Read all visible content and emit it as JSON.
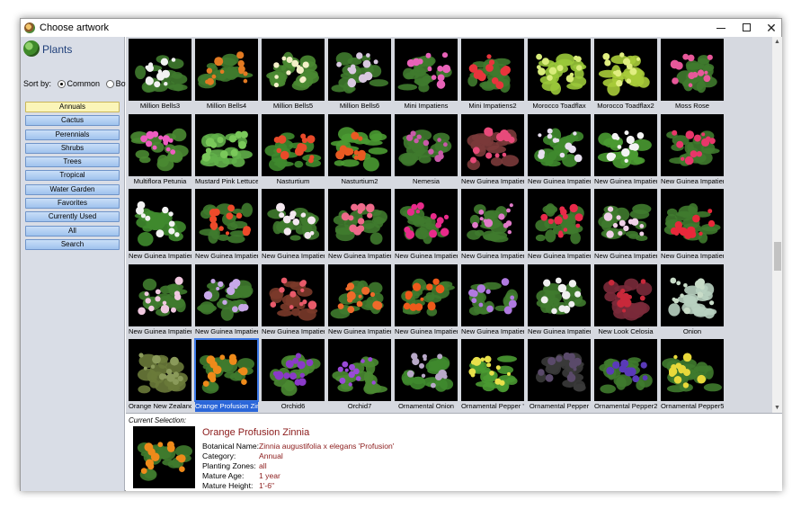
{
  "window": {
    "title": "Choose artwork",
    "controls": {
      "minimize": "minimize-icon",
      "maximize": "maximize-icon",
      "close": "✕"
    }
  },
  "sidebar": {
    "title": "Plants",
    "sort": {
      "label": "Sort by:",
      "options": [
        "Common",
        "Botanical"
      ],
      "selected": "Common"
    },
    "categories": [
      {
        "label": "Annuals",
        "active": true
      },
      {
        "label": "Cactus"
      },
      {
        "label": "Perennials"
      },
      {
        "label": "Shrubs"
      },
      {
        "label": "Trees"
      },
      {
        "label": "Tropical"
      },
      {
        "label": "Water Garden"
      },
      {
        "label": "Favorites"
      },
      {
        "label": "Currently Used"
      },
      {
        "label": "All"
      },
      {
        "label": "Search"
      }
    ]
  },
  "gallery": {
    "columns": 9,
    "selected_index": 37,
    "items": [
      {
        "label": "Million Bells3",
        "leaf": "#3f7a2e",
        "flower": "#f2f2f2"
      },
      {
        "label": "Million Bells4",
        "leaf": "#3f7a2e",
        "flower": "#e27a22"
      },
      {
        "label": "Million Bells5",
        "leaf": "#4a8a32",
        "flower": "#f4f0c8"
      },
      {
        "label": "Million Bells6",
        "leaf": "#3f7a2e",
        "flower": "#d8c8e0"
      },
      {
        "label": "Mini Impatiens",
        "leaf": "#3f7a2e",
        "flower": "#e862b8"
      },
      {
        "label": "Mini Impatiens2",
        "leaf": "#3f7a2e",
        "flower": "#e8343c"
      },
      {
        "label": "Morocco Toadflax",
        "leaf": "#9ac83a",
        "flower": "#d8ec7a"
      },
      {
        "label": "Morocco Toadflax2",
        "leaf": "#a8cc3a",
        "flower": "#e0ee80"
      },
      {
        "label": "Moss Rose",
        "leaf": "#3f7a2e",
        "flower": "#e8589a"
      },
      {
        "label": "Multiflora Petunia",
        "leaf": "#4a8a32",
        "flower": "#ee5cc0"
      },
      {
        "label": "Mustard Pink Lettuce",
        "leaf": "#62b04a",
        "flower": "#7ac85a"
      },
      {
        "label": "Nasturtium",
        "leaf": "#3f8a2e",
        "flower": "#e84a2a"
      },
      {
        "label": "Nasturtium2",
        "leaf": "#4a9a32",
        "flower": "#e85a22"
      },
      {
        "label": "Nemesia",
        "leaf": "#3f7a2e",
        "flower": "#c85aa8"
      },
      {
        "label": "New Guinea Impatiens",
        "leaf": "#7a3a3a",
        "flower": "#e84a7a"
      },
      {
        "label": "New Guinea Impatien...",
        "leaf": "#3f8a2e",
        "flower": "#e8e0f0"
      },
      {
        "label": "New Guinea Impatien...",
        "leaf": "#4a9a32",
        "flower": "#f4f4f4"
      },
      {
        "label": "New Guinea Impatien...",
        "leaf": "#3f7a2e",
        "flower": "#e8366a"
      },
      {
        "label": "New Guinea Impatien...",
        "leaf": "#3f8a2e",
        "flower": "#f2f2f2"
      },
      {
        "label": "New Guinea Impatien...",
        "leaf": "#3f7a2e",
        "flower": "#ee4a2a"
      },
      {
        "label": "New Guinea Impatien...",
        "leaf": "#3f7a2e",
        "flower": "#f4e8f0"
      },
      {
        "label": "New Guinea Impatien...",
        "leaf": "#3f7a2e",
        "flower": "#ee6a8a"
      },
      {
        "label": "New Guinea Impatien...",
        "leaf": "#3f7a2e",
        "flower": "#e82a8a"
      },
      {
        "label": "New Guinea Impatien...",
        "leaf": "#3f7a2e",
        "flower": "#e07ac8"
      },
      {
        "label": "New Guinea Impatien...",
        "leaf": "#3f7a2e",
        "flower": "#e82a4a"
      },
      {
        "label": "New Guinea Impatien...",
        "leaf": "#3f7a2e",
        "flower": "#f0d0e8"
      },
      {
        "label": "New Guinea Impatien...",
        "leaf": "#3f7a2e",
        "flower": "#e8283a"
      },
      {
        "label": "New Guinea Impatien...",
        "leaf": "#3f7a2e",
        "flower": "#f0c8e0"
      },
      {
        "label": "New Guinea Impatien...",
        "leaf": "#3f7a2e",
        "flower": "#c8a8e8"
      },
      {
        "label": "New Guinea Impatien...",
        "leaf": "#7a3a2a",
        "flower": "#e85a6a"
      },
      {
        "label": "New Guinea Impatien...",
        "leaf": "#3f7a2e",
        "flower": "#ee6a2a"
      },
      {
        "label": "New Guinea Impatien...",
        "leaf": "#3f7a2e",
        "flower": "#ee5a1a"
      },
      {
        "label": "New Guinea Impatien...",
        "leaf": "#3f7a2e",
        "flower": "#b07ae0"
      },
      {
        "label": "New Guinea Impatien...",
        "leaf": "#3f7a2e",
        "flower": "#f0f0f0"
      },
      {
        "label": "New Look Celosia",
        "leaf": "#7a2a3a",
        "flower": "#c8283a"
      },
      {
        "label": "Onion",
        "leaf": "#b8d0c0",
        "flower": "#c8dcc8"
      },
      {
        "label": "Orange New Zealand...",
        "leaf": "#6a7a3a",
        "flower": "#8a9a5a"
      },
      {
        "label": "Orange Profusion Zin...",
        "leaf": "#3f7a2e",
        "flower": "#ee8a1a"
      },
      {
        "label": "Orchid6",
        "leaf": "#4a8a32",
        "flower": "#8a3ac8"
      },
      {
        "label": "Orchid7",
        "leaf": "#4a8a32",
        "flower": "#9a4ad8"
      },
      {
        "label": "Ornamental Onion",
        "leaf": "#3f8a2e",
        "flower": "#b8a8c8"
      },
      {
        "label": "Ornamental Pepper 'C...",
        "leaf": "#4a9a32",
        "flower": "#e8e04a"
      },
      {
        "label": "Ornamental Pepper",
        "leaf": "#3a3a3a",
        "flower": "#5a4a6a"
      },
      {
        "label": "Ornamental Pepper2",
        "leaf": "#3f7a2e",
        "flower": "#5a3ab8"
      },
      {
        "label": "Ornamental Pepper5",
        "leaf": "#3f7a2e",
        "flower": "#e8d83a"
      }
    ]
  },
  "selection": {
    "heading": "Current Selection:",
    "name": "Orange Profusion Zinnia",
    "thumb": {
      "leaf": "#3f7a2e",
      "flower": "#ee8a1a"
    },
    "rows": [
      {
        "label": "Botanical Name:",
        "value": "Zinnia augustifolia x elegans 'Profusion'"
      },
      {
        "label": "Category:",
        "value": "Annual"
      },
      {
        "label": "Planting Zones:",
        "value": "all"
      },
      {
        "label": "Mature Age:",
        "value": "1 year"
      },
      {
        "label": "Mature Height:",
        "value": "1'-6\""
      }
    ]
  },
  "scrollbar": {
    "up": "▲",
    "down": "▼"
  }
}
